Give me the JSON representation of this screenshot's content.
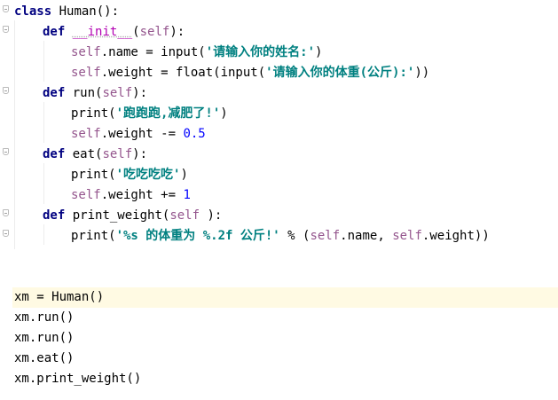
{
  "editor": {
    "lines": [
      {
        "t": [
          [
            "kw",
            "class"
          ],
          [
            "",
            " Human():"
          ]
        ]
      },
      {
        "t": [
          [
            "kw",
            "def"
          ],
          [
            "",
            " "
          ],
          [
            "magic",
            "__init__"
          ],
          [
            "",
            "("
          ],
          [
            "self",
            "self"
          ],
          [
            "",
            "):"
          ]
        ]
      },
      {
        "t": [
          [
            "self",
            "self"
          ],
          [
            "",
            ".name = input("
          ],
          [
            "str",
            "'请输入你的姓名:'"
          ],
          [
            "",
            ")"
          ]
        ]
      },
      {
        "t": [
          [
            "self",
            "self"
          ],
          [
            "",
            ".weight = float(input("
          ],
          [
            "str",
            "'请输入你的体重(公斤):'"
          ],
          [
            "",
            "))"
          ]
        ]
      },
      {
        "t": [
          [
            "kw",
            "def"
          ],
          [
            "",
            " run("
          ],
          [
            "self",
            "self"
          ],
          [
            "",
            "):"
          ]
        ]
      },
      {
        "t": [
          [
            "",
            "print("
          ],
          [
            "str",
            "'跑跑跑,减肥了!'"
          ],
          [
            "",
            ")"
          ]
        ]
      },
      {
        "t": [
          [
            "self",
            "self"
          ],
          [
            "",
            ".weight -= "
          ],
          [
            "num",
            "0.5"
          ]
        ]
      },
      {
        "t": [
          [
            "kw",
            "def"
          ],
          [
            "",
            " eat("
          ],
          [
            "self",
            "self"
          ],
          [
            "",
            "):"
          ]
        ]
      },
      {
        "t": [
          [
            "",
            "print("
          ],
          [
            "str",
            "'吃吃吃吃'"
          ],
          [
            "",
            ")"
          ]
        ]
      },
      {
        "t": [
          [
            "self",
            "self"
          ],
          [
            "",
            ".weight += "
          ],
          [
            "num",
            "1"
          ]
        ]
      },
      {
        "t": [
          [
            "kw",
            "def"
          ],
          [
            "",
            " print_weight("
          ],
          [
            "self",
            "self"
          ],
          [
            "",
            " ):"
          ]
        ]
      },
      {
        "t": [
          [
            "",
            "print("
          ],
          [
            "str",
            "'%s 的体重为 %.2f 公斤!'"
          ],
          [
            "",
            " % ("
          ],
          [
            "self",
            "self"
          ],
          [
            "",
            ".name, "
          ],
          [
            "self",
            "self"
          ],
          [
            "",
            ".weight))"
          ]
        ]
      },
      {
        "t": []
      },
      {
        "t": []
      },
      {
        "t": [
          [
            "",
            "xm = Human()"
          ]
        ]
      },
      {
        "t": [
          [
            "",
            "xm.run()"
          ]
        ]
      },
      {
        "t": [
          [
            "",
            "xm.run()"
          ]
        ]
      },
      {
        "t": [
          [
            "",
            "xm.eat()"
          ]
        ]
      },
      {
        "t": [
          [
            "",
            "xm.print_weight()"
          ]
        ]
      }
    ]
  }
}
